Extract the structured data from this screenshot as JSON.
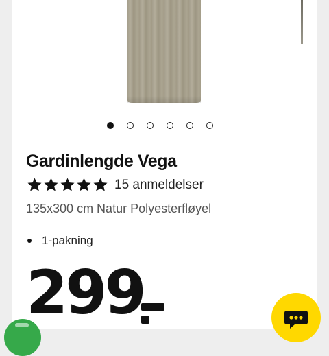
{
  "product": {
    "name": "Gardinlengde Vega",
    "rating": 5,
    "rating_max": 5,
    "reviews_label": "15 anmeldelser",
    "description": "135x300 cm Natur Polyesterfløyel",
    "features": [
      "1-pakning"
    ],
    "price": "299"
  },
  "gallery": {
    "image_count": 6,
    "active_index": 0
  },
  "colors": {
    "chat_button": "#ffd800",
    "badge": "#36a94a",
    "curtain": "#a59e8c"
  },
  "icons": {
    "chat": "chat-bubble-icon",
    "star": "star-icon"
  }
}
